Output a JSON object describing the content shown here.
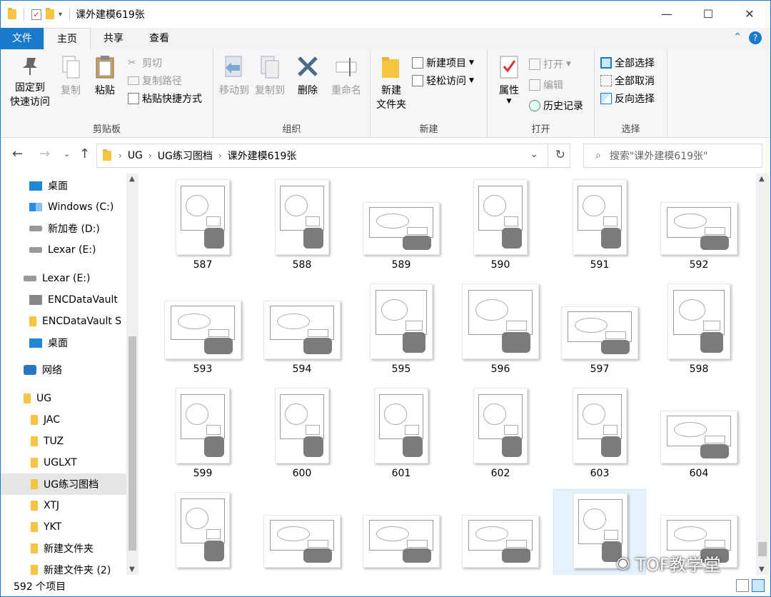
{
  "window": {
    "title": "课外建模619张",
    "controls": {
      "minimize": "—",
      "maximize": "☐",
      "close": "✕"
    }
  },
  "menubar": {
    "file": "文件",
    "tabs": [
      "主页",
      "共享",
      "查看"
    ],
    "right": {
      "collapse": "⌃",
      "help": "?"
    }
  },
  "ribbon": {
    "clipboard": {
      "label": "剪贴板",
      "pin": "固定到\n快速访问",
      "pin_l1": "固定到",
      "pin_l2": "快速访问",
      "copy": "复制",
      "paste": "粘贴",
      "cut": "剪切",
      "copy_path": "复制路径",
      "paste_shortcut": "粘贴快捷方式"
    },
    "organize": {
      "label": "组织",
      "move_to": "移动到",
      "copy_to": "复制到",
      "delete": "删除",
      "rename": "重命名"
    },
    "new": {
      "label": "新建",
      "new_folder_l1": "新建",
      "new_folder_l2": "文件夹",
      "new_item": "新建项目",
      "easy_access": "轻松访问"
    },
    "open": {
      "label": "打开",
      "properties": "属性",
      "open": "打开",
      "edit": "编辑",
      "history": "历史记录"
    },
    "select": {
      "label": "选择",
      "select_all": "全部选择",
      "select_none": "全部取消",
      "invert": "反向选择"
    }
  },
  "address": {
    "crumbs": [
      "UG",
      "UG练习图档",
      "课外建模619张"
    ],
    "search_placeholder": "搜索\"课外建模619张\""
  },
  "sidebar": {
    "items": [
      {
        "label": "桌面",
        "icon": "desktop-icon"
      },
      {
        "label": "Windows (C:)",
        "icon": "windows-drive-icon"
      },
      {
        "label": "新加卷 (D:)",
        "icon": "drive-icon"
      },
      {
        "label": "Lexar (E:)",
        "icon": "drive-icon"
      },
      {
        "label": "Lexar (E:)",
        "icon": "drive-icon"
      },
      {
        "label": "ENCDataVault",
        "icon": "vault-icon"
      },
      {
        "label": "ENCDataVault S",
        "icon": "folder-icon"
      },
      {
        "label": "桌面",
        "icon": "desktop-icon"
      },
      {
        "label": "网络",
        "icon": "network-icon"
      },
      {
        "label": "UG",
        "icon": "folder-icon"
      },
      {
        "label": "JAC",
        "icon": "folder-icon"
      },
      {
        "label": "TUZ",
        "icon": "folder-icon"
      },
      {
        "label": "UGLXT",
        "icon": "folder-icon"
      },
      {
        "label": "UG练习图档",
        "icon": "folder-icon"
      },
      {
        "label": "XTJ",
        "icon": "folder-icon"
      },
      {
        "label": "YKT",
        "icon": "folder-icon"
      },
      {
        "label": "新建文件夹",
        "icon": "folder-icon"
      },
      {
        "label": "新建文件夹 (2)",
        "icon": "folder-icon"
      }
    ]
  },
  "files": [
    {
      "name": "587"
    },
    {
      "name": "588"
    },
    {
      "name": "589"
    },
    {
      "name": "590"
    },
    {
      "name": "591"
    },
    {
      "name": "592"
    },
    {
      "name": "593"
    },
    {
      "name": "594"
    },
    {
      "name": "595"
    },
    {
      "name": "596"
    },
    {
      "name": "597"
    },
    {
      "name": "598"
    },
    {
      "name": "599"
    },
    {
      "name": "600"
    },
    {
      "name": "601"
    },
    {
      "name": "602"
    },
    {
      "name": "603"
    },
    {
      "name": "604"
    },
    {
      "name": ""
    },
    {
      "name": ""
    },
    {
      "name": ""
    },
    {
      "name": ""
    },
    {
      "name": ""
    },
    {
      "name": ""
    }
  ],
  "status": {
    "count": "592 个项目"
  },
  "watermark": "TOF教学堂",
  "colors": {
    "accent": "#1979ca",
    "folder": "#f5c542",
    "selection": "#e5f1fb"
  }
}
